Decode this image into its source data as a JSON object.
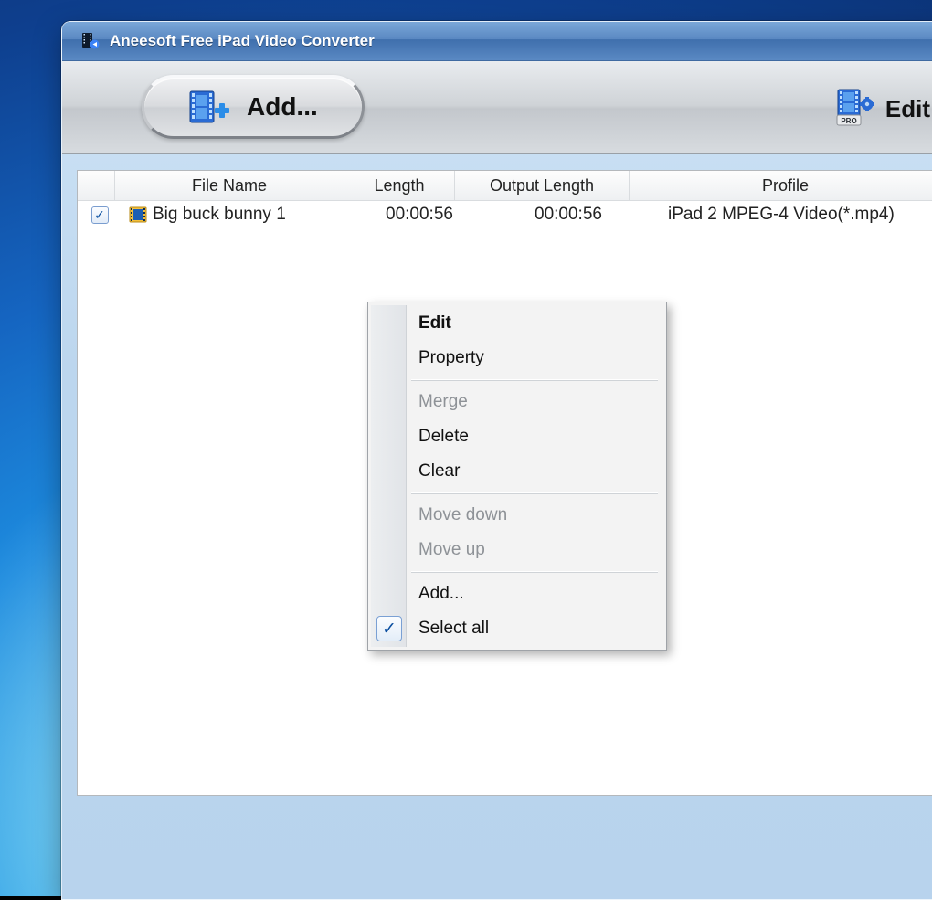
{
  "window": {
    "title": "Aneesoft Free iPad Video Converter"
  },
  "toolbar": {
    "add_label": "Add...",
    "edit_label": "Edit"
  },
  "table": {
    "columns": {
      "file_name": "File Name",
      "length": "Length",
      "output_length": "Output Length",
      "profile": "Profile"
    },
    "rows": [
      {
        "checked": true,
        "file_name": "Big buck bunny 1",
        "length": "00:00:56",
        "output_length": "00:00:56",
        "profile": "iPad 2 MPEG-4 Video(*.mp4)"
      }
    ]
  },
  "context_menu": {
    "items": {
      "edit": "Edit",
      "property": "Property",
      "merge": "Merge",
      "delete": "Delete",
      "clear": "Clear",
      "move_down": "Move down",
      "move_up": "Move up",
      "add": "Add...",
      "select_all": "Select all"
    },
    "select_all_checked": true
  }
}
